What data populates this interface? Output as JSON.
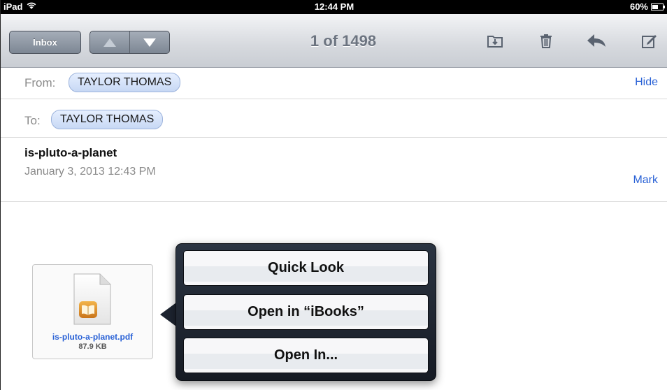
{
  "status": {
    "device": "iPad",
    "time": "12:44 PM",
    "battery": "60%",
    "battery_level": 0.6
  },
  "toolbar": {
    "inbox_label": "Inbox",
    "counter": "1 of 1498"
  },
  "header": {
    "from_label": "From:",
    "from_name": "TAYLOR THOMAS",
    "hide_label": "Hide",
    "to_label": "To:",
    "to_name": "TAYLOR THOMAS",
    "subject": "is-pluto-a-planet",
    "date": "January 3, 2013 12:43 PM",
    "mark_label": "Mark"
  },
  "attachment": {
    "name": "is-pluto-a-planet.pdf",
    "size": "87.9 KB"
  },
  "popover": {
    "options": [
      {
        "label": "Quick Look"
      },
      {
        "label": "Open in “iBooks”"
      },
      {
        "label": "Open In..."
      }
    ]
  },
  "colors": {
    "link": "#2a62d6",
    "pill_border": "#9cb3dc",
    "popover_bg": "#1d2430"
  }
}
